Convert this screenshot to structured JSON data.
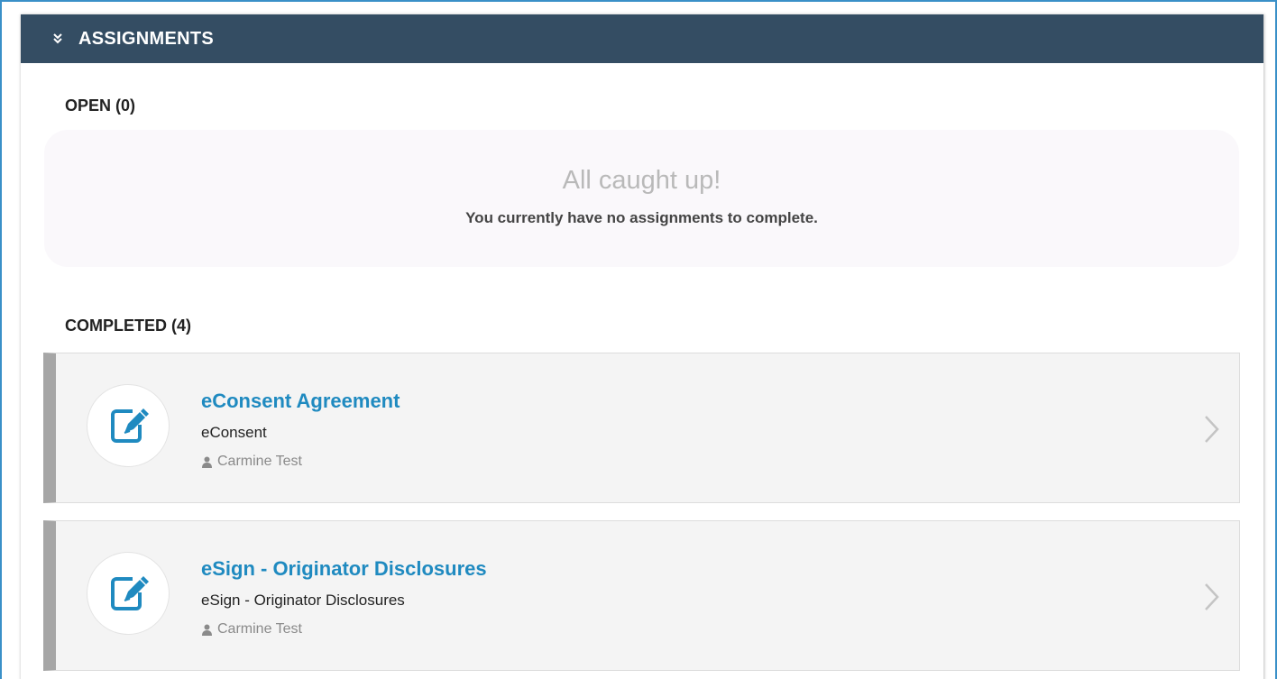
{
  "header": {
    "title": "ASSIGNMENTS",
    "toggle_icon": "double-chevron-down-icon",
    "background_color": "#344d63"
  },
  "open": {
    "label": "OPEN (0)",
    "empty_title": "All caught up!",
    "empty_message": "You currently have no assignments to complete."
  },
  "completed": {
    "label": "COMPLETED (4)",
    "items": [
      {
        "title": "eConsent Agreement",
        "type": "eConsent",
        "user": "Carmine Test",
        "icon": "document-signature-icon"
      },
      {
        "title": "eSign - Originator Disclosures",
        "type": "eSign - Originator Disclosures",
        "user": "Carmine Test",
        "icon": "document-signature-icon"
      }
    ]
  },
  "colors": {
    "accent": "#1f8ac0",
    "card_stripe": "#a6a6a6",
    "frame_border": "#3a90c8"
  }
}
